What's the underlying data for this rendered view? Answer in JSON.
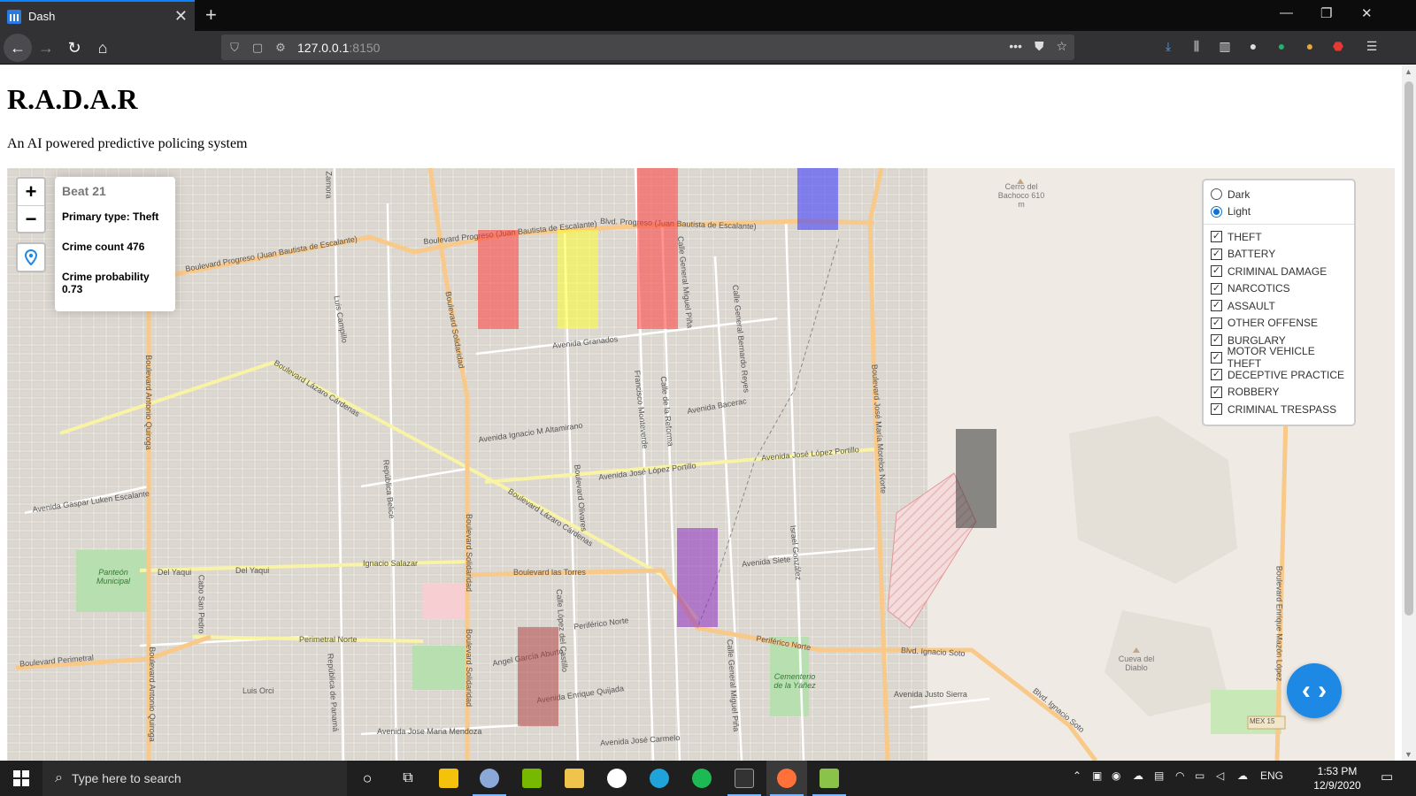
{
  "browser": {
    "tab_title": "Dash",
    "url_host": "127.0.0.1",
    "url_port": ":8150"
  },
  "page": {
    "title": "R.A.D.A.R",
    "subtitle": "An AI powered predictive policing system"
  },
  "info_panel": {
    "beat": "Beat 21",
    "primary_type": "Primary type: Theft",
    "crime_count": "Crime count 476",
    "crime_probability": "Crime probability 0.73"
  },
  "zoom": {
    "in_label": "+",
    "out_label": "−"
  },
  "layers": {
    "base": [
      {
        "label": "Dark",
        "selected": false
      },
      {
        "label": "Light",
        "selected": true
      }
    ],
    "crimes": [
      "THEFT",
      "BATTERY",
      "CRIMINAL DAMAGE",
      "NARCOTICS",
      "ASSAULT",
      "OTHER OFFENSE",
      "BURGLARY",
      "MOTOR VEHICLE THEFT",
      "DECEPTIVE PRACTICE",
      "ROBBERY",
      "CRIMINAL TRESPASS"
    ]
  },
  "beat_colors": {
    "red": "#ff3a3a",
    "yellow": "#ffff33",
    "blue": "#3333ff",
    "purple": "#8c2bbf",
    "dark_red": "#b24545",
    "gray": "#333333"
  },
  "map_labels": {
    "blvd_progreso_w": "Boulevard Progreso (Juan Bautista de Escalante)",
    "blvd_progreso_e": "Boulevard Progreso (Juan Bautista de Escalante)",
    "blvd_progreso_ne": "Blvd. Progreso (Juan Bautista de Escalante)",
    "zamora": "Zamora",
    "luis_campillo": "Luis Campillo",
    "blvd_solidaridad": "Boulevard Solidaridad",
    "blvd_solidaridad_2": "Boulevard Solidaridad",
    "blvd_solidaridad_3": "Boulevard Solidaridad",
    "antonio_quiroga": "Boulevard Antonio Quiroga",
    "antonio_quiroga_2": "Boulevard Antonio Quiroga",
    "lazaro_cardenas": "Boulevard Lázaro Cárdenas",
    "lazaro_cardenas_2": "Boulevard Lázaro Cárdenas",
    "avenida_granados": "Avenida Granados",
    "calle_miguel_pina": "Calle General Miguel Piña",
    "calle_bernardo_reyes": "Calle General Bernardo Reyes",
    "francisco_monteverde": "Francisco Monteverde",
    "calle_reforma": "Calle de la Reforma",
    "avenida_bacerac": "Avenida Bacerac",
    "ignacio_altamirano": "Avenida Ignacio M Altamirano",
    "lopez_portillo": "Avenida José López Portillo",
    "lopez_portillo_2": "Avenida José López Portillo",
    "gaspar_luken": "Avenida Gaspar Luken Escalante",
    "republica_belice": "República Belice",
    "boulevard_olivares": "Boulevard Olivares",
    "jose_maria_morelos": "Boulevard José María Morelos Norte",
    "panteon": "Panteón Municipal",
    "del_yaqui": "Del Yaqui",
    "del_yaqui_2": "Del Yaqui",
    "cabo_san_pedro": "Cabo San Pedro",
    "ignacio_salazar": "Ignacio Salazar",
    "blvd_las_torres": "Boulevard las Torres",
    "lopez_castillo": "Calle López del Castillo",
    "avenida_siete": "Avenida Siete",
    "israel_gonzalez": "Israel González",
    "periferico_norte": "Periférico Norte",
    "periferico_norte_2": "Periférico Norte",
    "perimetral_norte": "Perimetral Norte",
    "blvd_perimetral": "Boulevard Perimetral",
    "republica_panama": "República de Panamá",
    "angel_aburto": "Angel García Aburto",
    "enrique_quijada": "Avenida Enrique Quijada",
    "calle_miguel_pina_2": "Calle General Miguel Piña",
    "cementerio": "Cementerio de la Yáñez",
    "blvd_ignacio_soto": "Blvd. Ignacio Soto",
    "blvd_ignacio_soto_2": "Blvd. Ignacio Soto",
    "justo_sierra": "Avenida Justo Sierra",
    "luis_orci": "Luis Orci",
    "jose_maria_mendoza": "Avenida Jose Maria Mendoza",
    "jose_carmelo": "Avenida José Carmelo",
    "cerro_bachoco": "Cerro del Bachoco 610 m",
    "cueva_diablo": "Cueva del Diablo",
    "enrique_mazon": "Boulevard Enrique Mazón López",
    "mex15": "MEX 15"
  },
  "taskbar": {
    "search_placeholder": "Type here to search",
    "lang": "ENG",
    "time": "1:53 PM",
    "date": "12/9/2020"
  },
  "icons": {
    "back": "arrow-left-icon",
    "forward": "arrow-right-icon",
    "reload": "reload-icon",
    "home": "home-icon",
    "locate": "map-pin-icon",
    "fab": "code-brackets-icon"
  }
}
